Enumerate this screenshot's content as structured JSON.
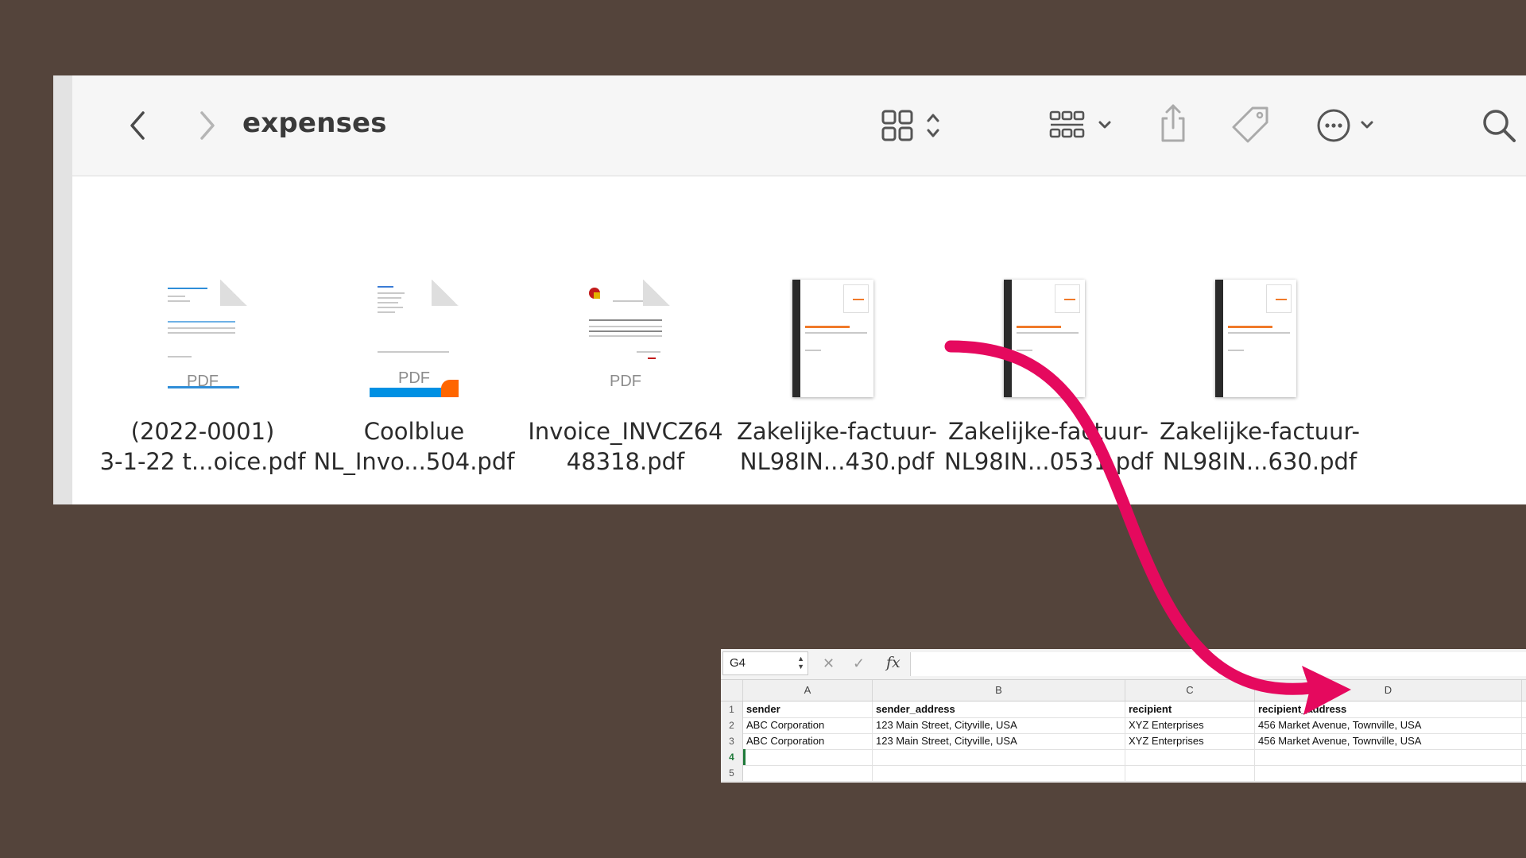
{
  "finder": {
    "title": "expenses",
    "toolbar": {
      "back_icon": "chevron-left-icon",
      "forward_icon": "chevron-right-icon",
      "view_icon": "icon-grid-icon",
      "group_icon": "group-by-icon",
      "share_icon": "share-icon",
      "tag_icon": "tag-icon",
      "more_icon": "ellipsis-circle-icon",
      "search_icon": "search-icon"
    },
    "files": [
      {
        "line1": "(2022-0001)",
        "line2": "3-1-22 t...oice.pdf",
        "thumb_label": "PDF"
      },
      {
        "line1": "Coolblue",
        "line2": "NL_Invo...504.pdf",
        "thumb_label": "PDF"
      },
      {
        "line1": "Invoice_INVCZ64",
        "line2": "48318.pdf",
        "thumb_label": "PDF"
      },
      {
        "line1": "Zakelijke-factuur-",
        "line2": "NL98IN...430.pdf"
      },
      {
        "line1": "Zakelijke-factuur-",
        "line2": "NL98IN...0531.pdf"
      },
      {
        "line1": "Zakelijke-factuur-",
        "line2": "NL98IN...630.pdf"
      }
    ]
  },
  "spreadsheet": {
    "name_box": "G4",
    "fx_label": "fx",
    "cancel_icon": "x-icon",
    "confirm_icon": "checkmark-icon",
    "columns": [
      "A",
      "B",
      "C",
      "D"
    ],
    "row_numbers": [
      "1",
      "2",
      "3",
      "4",
      "5"
    ],
    "rows": [
      [
        "sender",
        "sender_address",
        "recipient",
        "recipient_address"
      ],
      [
        "ABC Corporation",
        "123 Main Street, Cityville, USA",
        "XYZ Enterprises",
        "456 Market Avenue, Townville, USA"
      ],
      [
        "ABC Corporation",
        "123 Main Street, Cityville, USA",
        "XYZ Enterprises",
        "456 Market Avenue, Townville, USA"
      ],
      [
        "",
        "",
        "",
        ""
      ],
      [
        "",
        "",
        "",
        ""
      ]
    ],
    "active_row": "4",
    "active_color": "#1f7a3a"
  },
  "annotation": {
    "arrow_color": "#e5095e"
  }
}
